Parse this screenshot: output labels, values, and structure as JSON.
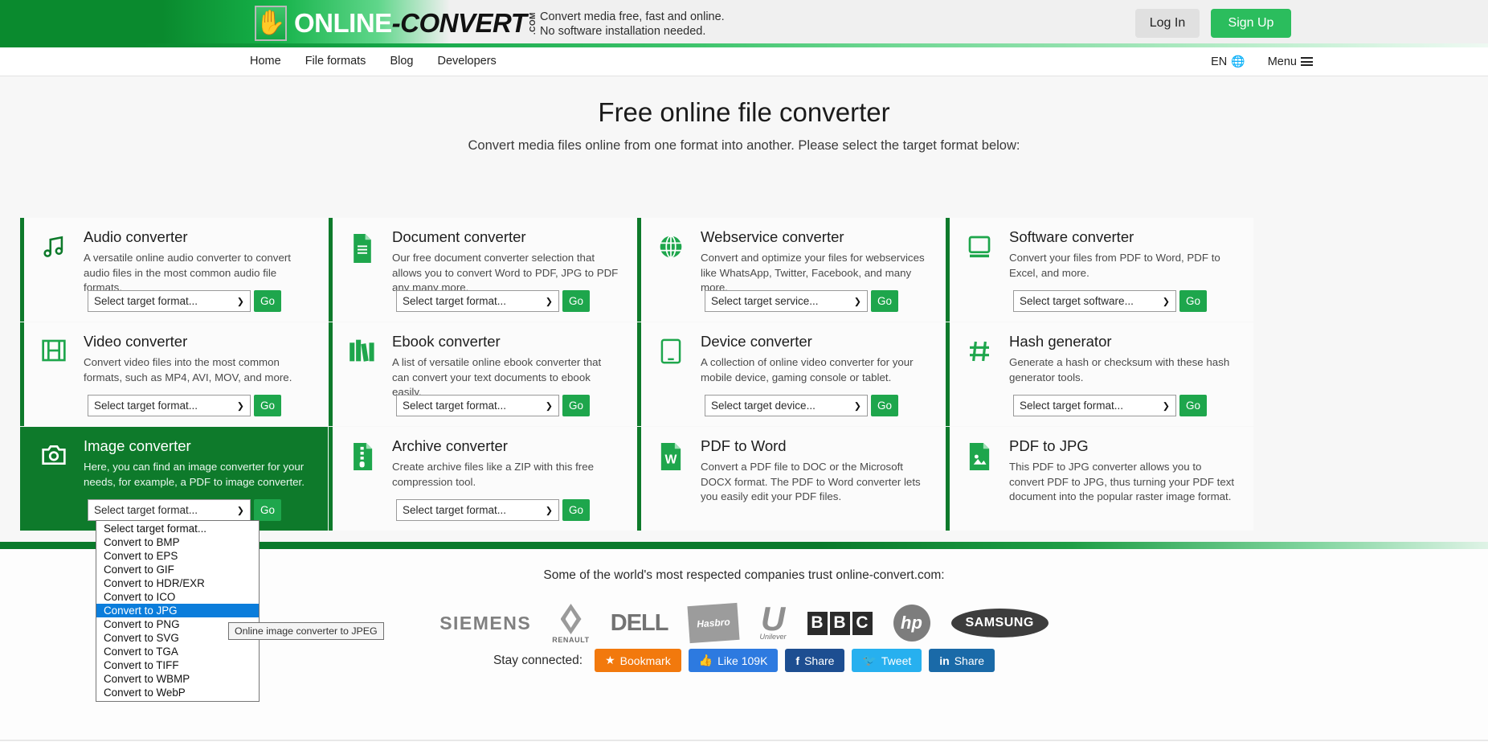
{
  "header": {
    "logo": {
      "online": "ONLINE",
      "convert": "-CONVERT",
      "dotcom": ".COM",
      "figure_icon": "person-logo-icon"
    },
    "tagline_line1": "Convert media free, fast and online.",
    "tagline_line2": "No software installation needed.",
    "login_label": "Log In",
    "signup_label": "Sign Up"
  },
  "nav": {
    "items": [
      {
        "label": "Home"
      },
      {
        "label": "File formats"
      },
      {
        "label": "Blog"
      },
      {
        "label": "Developers"
      }
    ],
    "language": "EN",
    "menu_label": "Menu"
  },
  "hero": {
    "title": "Free online file converter",
    "subtitle": "Convert media files online from one format into another. Please select the target format below:"
  },
  "cards": [
    {
      "icon": "music-note-icon",
      "title": "Audio converter",
      "desc": "A versatile online audio converter to convert audio files in the most common audio file formats.",
      "select_value": "Select target format...",
      "go_label": "Go",
      "active": false
    },
    {
      "icon": "document-icon",
      "title": "Document converter",
      "desc": "Our free document converter selection that allows you to convert Word to PDF, JPG to PDF any many more.",
      "select_value": "Select target format...",
      "go_label": "Go",
      "active": false
    },
    {
      "icon": "globe-icon",
      "title": "Webservice converter",
      "desc": "Convert and optimize your files for webservices like WhatsApp, Twitter, Facebook, and many more.",
      "select_value": "Select target service...",
      "go_label": "Go",
      "active": false
    },
    {
      "icon": "monitor-icon",
      "title": "Software converter",
      "desc": "Convert your files from PDF to Word, PDF to Excel, and more.",
      "select_value": "Select target software...",
      "go_label": "Go",
      "active": false
    },
    {
      "icon": "film-icon",
      "title": "Video converter",
      "desc": "Convert video files into the most common formats, such as MP4, AVI, MOV, and more.",
      "select_value": "Select target format...",
      "go_label": "Go",
      "active": false
    },
    {
      "icon": "books-icon",
      "title": "Ebook converter",
      "desc": "A list of versatile online ebook converter that can convert your text documents to ebook easily.",
      "select_value": "Select target format...",
      "go_label": "Go",
      "active": false
    },
    {
      "icon": "tablet-icon",
      "title": "Device converter",
      "desc": "A collection of online video converter for your mobile device, gaming console or tablet.",
      "select_value": "Select target device...",
      "go_label": "Go",
      "active": false
    },
    {
      "icon": "hash-icon",
      "title": "Hash generator",
      "desc": "Generate a hash or checksum with these hash generator tools.",
      "select_value": "Select target format...",
      "go_label": "Go",
      "active": false
    },
    {
      "icon": "camera-icon",
      "title": "Image converter",
      "desc": "Here, you can find an image converter for your needs, for example, a PDF to image converter.",
      "select_value": "Select target format...",
      "go_label": "Go",
      "active": true
    },
    {
      "icon": "archive-icon",
      "title": "Archive converter",
      "desc": "Create archive files like a ZIP with this free compression tool.",
      "select_value": "Select target format...",
      "go_label": "Go",
      "active": false
    },
    {
      "icon": "word-icon",
      "title": "PDF to Word",
      "desc": "Convert a PDF file to DOC or the Microsoft DOCX format. The PDF to Word converter lets you easily edit your PDF files.",
      "select_value": "",
      "go_label": "",
      "active": false
    },
    {
      "icon": "image-file-icon",
      "title": "PDF to JPG",
      "desc": "This PDF to JPG converter allows you to convert PDF to JPG, thus turning your PDF text document into the popular raster image format.",
      "select_value": "",
      "go_label": "",
      "active": false
    }
  ],
  "dropdown": {
    "options": [
      "Select target format...",
      "Convert to BMP",
      "Convert to EPS",
      "Convert to GIF",
      "Convert to HDR/EXR",
      "Convert to ICO",
      "Convert to JPG",
      "Convert to PNG",
      "Convert to SVG",
      "Convert to TGA",
      "Convert to TIFF",
      "Convert to WBMP",
      "Convert to WebP"
    ],
    "highlighted_index": 6,
    "tooltip": "Online image converter to JPEG"
  },
  "trust": {
    "headline": "Some of the world's most respected companies trust online-convert.com:",
    "logos": [
      {
        "name": "SIEMENS"
      },
      {
        "name": "RENAULT"
      },
      {
        "name": "DELL"
      },
      {
        "name": "Hasbro"
      },
      {
        "name": "Unilever"
      },
      {
        "name": "BBC"
      },
      {
        "name": "hp"
      },
      {
        "name": "SAMSUNG"
      }
    ]
  },
  "social": {
    "label": "Stay connected:",
    "buttons": [
      {
        "label": "Bookmark",
        "icon": "star-icon",
        "color": "#f2790d"
      },
      {
        "label": "Like 109K",
        "icon": "thumbs-up-icon",
        "color": "#2d7ae0"
      },
      {
        "label": "Share",
        "icon": "facebook-icon",
        "color": "#1d4e91"
      },
      {
        "label": "Tweet",
        "icon": "twitter-icon",
        "color": "#27b0ef"
      },
      {
        "label": "Share",
        "icon": "linkedin-icon",
        "color": "#1a6aa8"
      }
    ]
  },
  "colors": {
    "brand_green": "#0e7a2b",
    "accent_green": "#1ea64c",
    "highlight_blue": "#0b7ddb"
  }
}
